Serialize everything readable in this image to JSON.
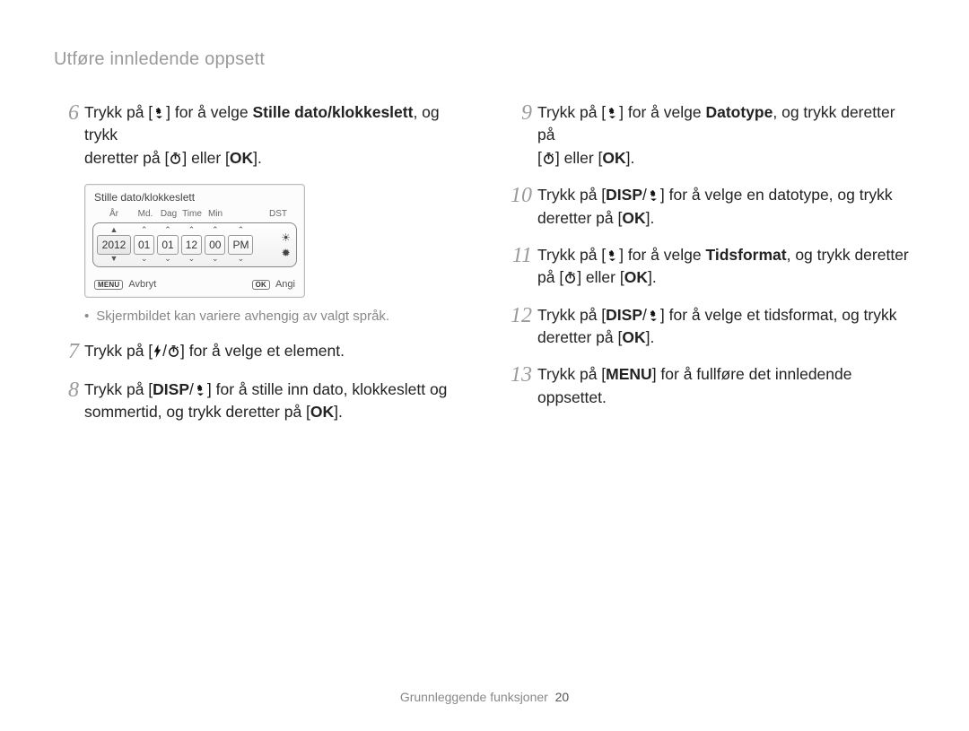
{
  "header": {
    "title": "Utføre innledende oppsett"
  },
  "text": {
    "trykk_pa": "Trykk på [",
    "velge": "] for å velge ",
    "og_trykk_deretter_pa": ", og trykk deretter på [",
    "eller": "] eller [",
    "close": "].",
    "deretter_pa": "deretter på [",
    "velge_en_datotype": "] for å velge en datotype, og trykk",
    "velge_tidsformat_tail": ", og trykk deretter",
    "pa_open": "på [",
    "velge_et_tidsformat": "] for å velge et tidsformat, og trykk",
    "fullfore": "] for å fullføre det innledende oppsettet.",
    "velge_element": "] for å velge et element.",
    "stille_inn": "] for å stille inn dato, klokkeslett og",
    "sommertid": "sommertid, og trykk deretter på [",
    "og_trykk_deretter_pa_line2": ", og trykk",
    "slash": "/"
  },
  "bold": {
    "stille": "Stille dato/klokkeslett",
    "datotype": "Datotype",
    "tidsformat": "Tidsformat"
  },
  "glyph": {
    "disp": "DISP",
    "ok": "OK",
    "menu": "MENU"
  },
  "steps": {
    "n6": "6",
    "n7": "7",
    "n8": "8",
    "n9": "9",
    "n10": "10",
    "n11": "11",
    "n12": "12",
    "n13": "13"
  },
  "device": {
    "title": "Stille dato/klokkeslett",
    "head": {
      "ar": "År",
      "md": "Md.",
      "dag": "Dag",
      "time": "Time",
      "min": "Min",
      "dst": "DST"
    },
    "vals": {
      "year": "2012",
      "md": "01",
      "dag": "01",
      "time": "12",
      "min": "00",
      "pm": "PM"
    },
    "foot": {
      "menu_badge": "MENU",
      "avbryt": "Avbryt",
      "ok_badge": "OK",
      "angi": "Angi"
    }
  },
  "note": {
    "text": "Skjermbildet kan variere avhengig av valgt språk."
  },
  "footer": {
    "section": "Grunnleggende funksjoner",
    "page": "20"
  }
}
